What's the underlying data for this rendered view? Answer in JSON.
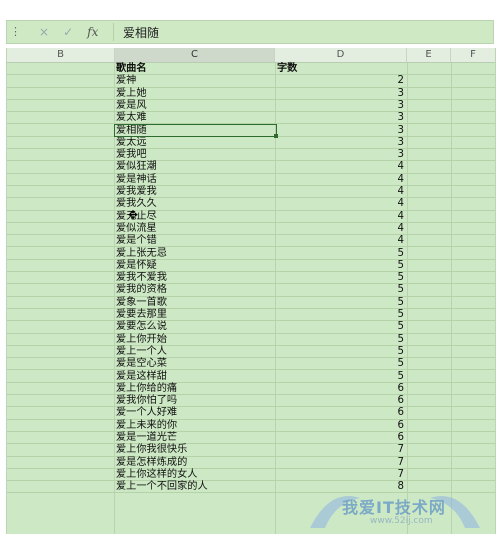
{
  "formula_bar": {
    "cancel_icon": "×",
    "confirm_icon": "✓",
    "fx_label": "fx",
    "content": "爱相随"
  },
  "columns": [
    "B",
    "C",
    "D",
    "E",
    "F"
  ],
  "active_column": "C",
  "header_row": {
    "title": "歌曲名",
    "count": "字数"
  },
  "rows": [
    [
      "爱神",
      "2"
    ],
    [
      "爱上她",
      "3"
    ],
    [
      "爱是风",
      "3"
    ],
    [
      "爱太难",
      "3"
    ],
    [
      "爱相随",
      "3"
    ],
    [
      "爱太远",
      "3"
    ],
    [
      "爱我吧",
      "3"
    ],
    [
      "爱似狂潮",
      "4"
    ],
    [
      "爱是神话",
      "4"
    ],
    [
      "爱我爱我",
      "4"
    ],
    [
      "爱我久久",
      "4"
    ],
    [
      "爱无止尽",
      "4"
    ],
    [
      "爱似流星",
      "4"
    ],
    [
      "爱是个错",
      "4"
    ],
    [
      "爱上张无忌",
      "5"
    ],
    [
      "爱是怀疑",
      "5"
    ],
    [
      "爱我不爱我",
      "5"
    ],
    [
      "爱我的资格",
      "5"
    ],
    [
      "爱象一首歌",
      "5"
    ],
    [
      "爱要去那里",
      "5"
    ],
    [
      "爱要怎么说",
      "5"
    ],
    [
      "爱上你开始",
      "5"
    ],
    [
      "爱上一个人",
      "5"
    ],
    [
      "爱是空心菜",
      "5"
    ],
    [
      "爱是这样甜",
      "5"
    ],
    [
      "爱上你给的痛",
      "6"
    ],
    [
      "爱我你怕了吗",
      "6"
    ],
    [
      "爱一个人好难",
      "6"
    ],
    [
      "爱上未来的你",
      "6"
    ],
    [
      "爱是一道光芒",
      "6"
    ],
    [
      "爱上你我很快乐",
      "7"
    ],
    [
      "爱是怎样炼成的",
      "7"
    ],
    [
      "爱上你这样的女人",
      "7"
    ],
    [
      "爱上一个不回家的人",
      "8"
    ]
  ],
  "selected_row_index": 4,
  "watermark": {
    "text": "我爱IT技术网",
    "sub": "www.52ij.com"
  }
}
